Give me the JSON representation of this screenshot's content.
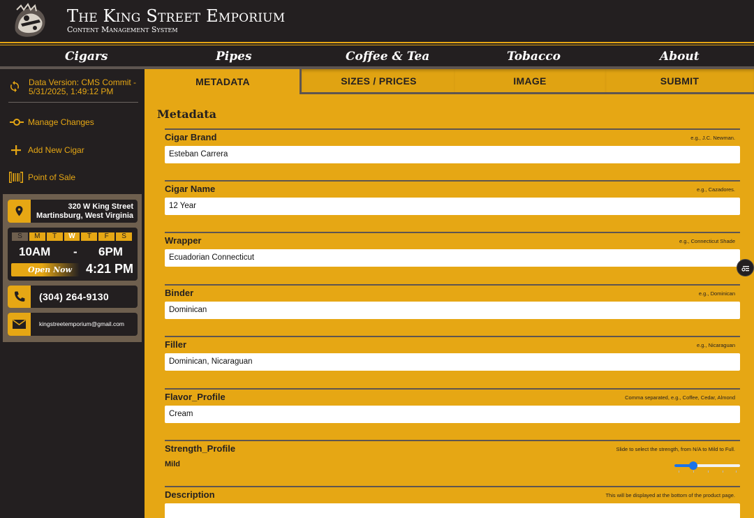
{
  "header": {
    "title": "The King Street Emporium",
    "subtitle": "Content Management System",
    "logo_icon": "emporium-logo"
  },
  "nav": {
    "items": [
      {
        "label": "Cigars"
      },
      {
        "label": "Pipes"
      },
      {
        "label": "Coffee & Tea"
      },
      {
        "label": "Tobacco"
      },
      {
        "label": "About"
      }
    ]
  },
  "sidebar": {
    "version_icon": "sync-icon",
    "version_text": "Data Version: CMS Commit - 5/31/2025, 1:49:12 PM",
    "links": [
      {
        "label": "Manage Changes",
        "icon": "commit-icon"
      },
      {
        "label": "Add New Cigar",
        "icon": "plus-icon"
      },
      {
        "label": "Point of Sale",
        "icon": "barcode-icon"
      }
    ],
    "address": {
      "line1": "320 W King Street",
      "line2": "Martinsburg, West Virginia"
    },
    "hours": {
      "days": [
        {
          "label": "S",
          "state": "off"
        },
        {
          "label": "M",
          "state": "on"
        },
        {
          "label": "T",
          "state": "on"
        },
        {
          "label": "W",
          "state": "current"
        },
        {
          "label": "T",
          "state": "on"
        },
        {
          "label": "F",
          "state": "on"
        },
        {
          "label": "S",
          "state": "on"
        }
      ],
      "open": "10AM",
      "separator": "-",
      "close": "6PM",
      "status": "Open Now",
      "current_time": "4:21 PM"
    },
    "phone": "(304) 264-9130",
    "email": "kingstreetemporium@gmail.com"
  },
  "tabs": [
    {
      "label": "METADATA",
      "active": true
    },
    {
      "label": "SIZES / PRICES",
      "active": false
    },
    {
      "label": "IMAGE",
      "active": false
    },
    {
      "label": "SUBMIT",
      "active": false
    }
  ],
  "main": {
    "section_title": "Metadata",
    "fields": {
      "brand": {
        "label": "Cigar Brand",
        "hint": "e.g., J.C. Newman.",
        "value": "Esteban Carrera"
      },
      "name": {
        "label": "Cigar Name",
        "hint": "e.g., Cazadores.",
        "value": "12 Year"
      },
      "wrapper": {
        "label": "Wrapper",
        "hint": "e.g., Connecticut Shade",
        "value": "Ecuadorian Connecticut"
      },
      "binder": {
        "label": "Binder",
        "hint": "e.g., Dominican",
        "value": "Dominican"
      },
      "filler": {
        "label": "Filler",
        "hint": "e.g., Nicaraguan",
        "value": "Dominican, Nicaraguan"
      },
      "flavor": {
        "label": "Flavor_Profile",
        "hint": "Comma separated, e.g., Coffee, Cedar, Almond",
        "value": "Cream"
      },
      "strength": {
        "label": "Strength_Profile",
        "hint": "Slide to select the strength, from N/A to Mild to Full.",
        "value": "Mild",
        "level": 0.25
      },
      "description": {
        "label": "Description",
        "hint": "This will be displayed at the bottom of the product page.",
        "value": ""
      }
    }
  },
  "colors": {
    "accent": "#e6a714",
    "dark": "#231f20",
    "slider": "#1a73e8"
  }
}
